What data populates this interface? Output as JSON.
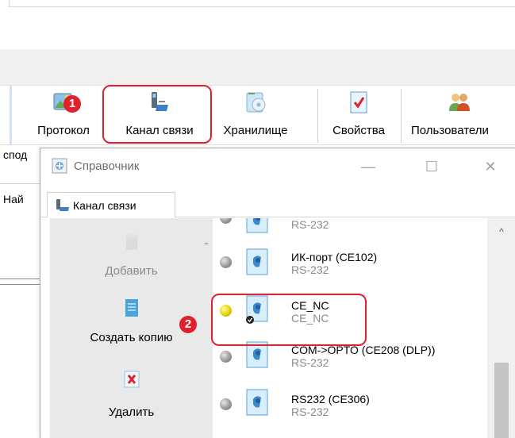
{
  "toolbar": {
    "buttons": [
      {
        "label": "Протокол",
        "icon": "protocol-icon"
      },
      {
        "label": "Канал связи",
        "icon": "channel-icon"
      },
      {
        "label": "Хранилище",
        "icon": "storage-icon"
      },
      {
        "label": "Свойства",
        "icon": "properties-icon"
      },
      {
        "label": "Пользователи",
        "icon": "users-icon"
      }
    ]
  },
  "background_window": {
    "label1": "спод",
    "label2": "Най"
  },
  "annotations": {
    "badge1": "1",
    "badge2": "2",
    "color": "#e0202a"
  },
  "dialog": {
    "title": "Справочник",
    "controls": {
      "minimize": "—",
      "maximize": "☐",
      "close": "✕"
    },
    "tab": {
      "label": "Канал связи"
    },
    "actions": [
      {
        "label": "Добавить",
        "icon": "add-icon",
        "enabled": false
      },
      {
        "label": "Создать копию",
        "icon": "copy-icon",
        "enabled": true
      },
      {
        "label": "Удалить",
        "icon": "delete-icon",
        "enabled": true
      }
    ],
    "list": [
      {
        "name": "",
        "port": "RS-232",
        "status": "gray"
      },
      {
        "name": "ИК-порт (CE102)",
        "port": "RS-232",
        "status": "gray"
      },
      {
        "name": "CE_NC",
        "port": "CE_NC",
        "status": "yellow",
        "selected_default": true
      },
      {
        "name": "COM->OPTO (CE208 (DLP))",
        "port": "RS-232",
        "status": "gray"
      },
      {
        "name": "RS232 (CE306)",
        "port": "RS-232",
        "status": "gray"
      }
    ]
  },
  "scrollbar": {
    "up_arrow": "^"
  }
}
